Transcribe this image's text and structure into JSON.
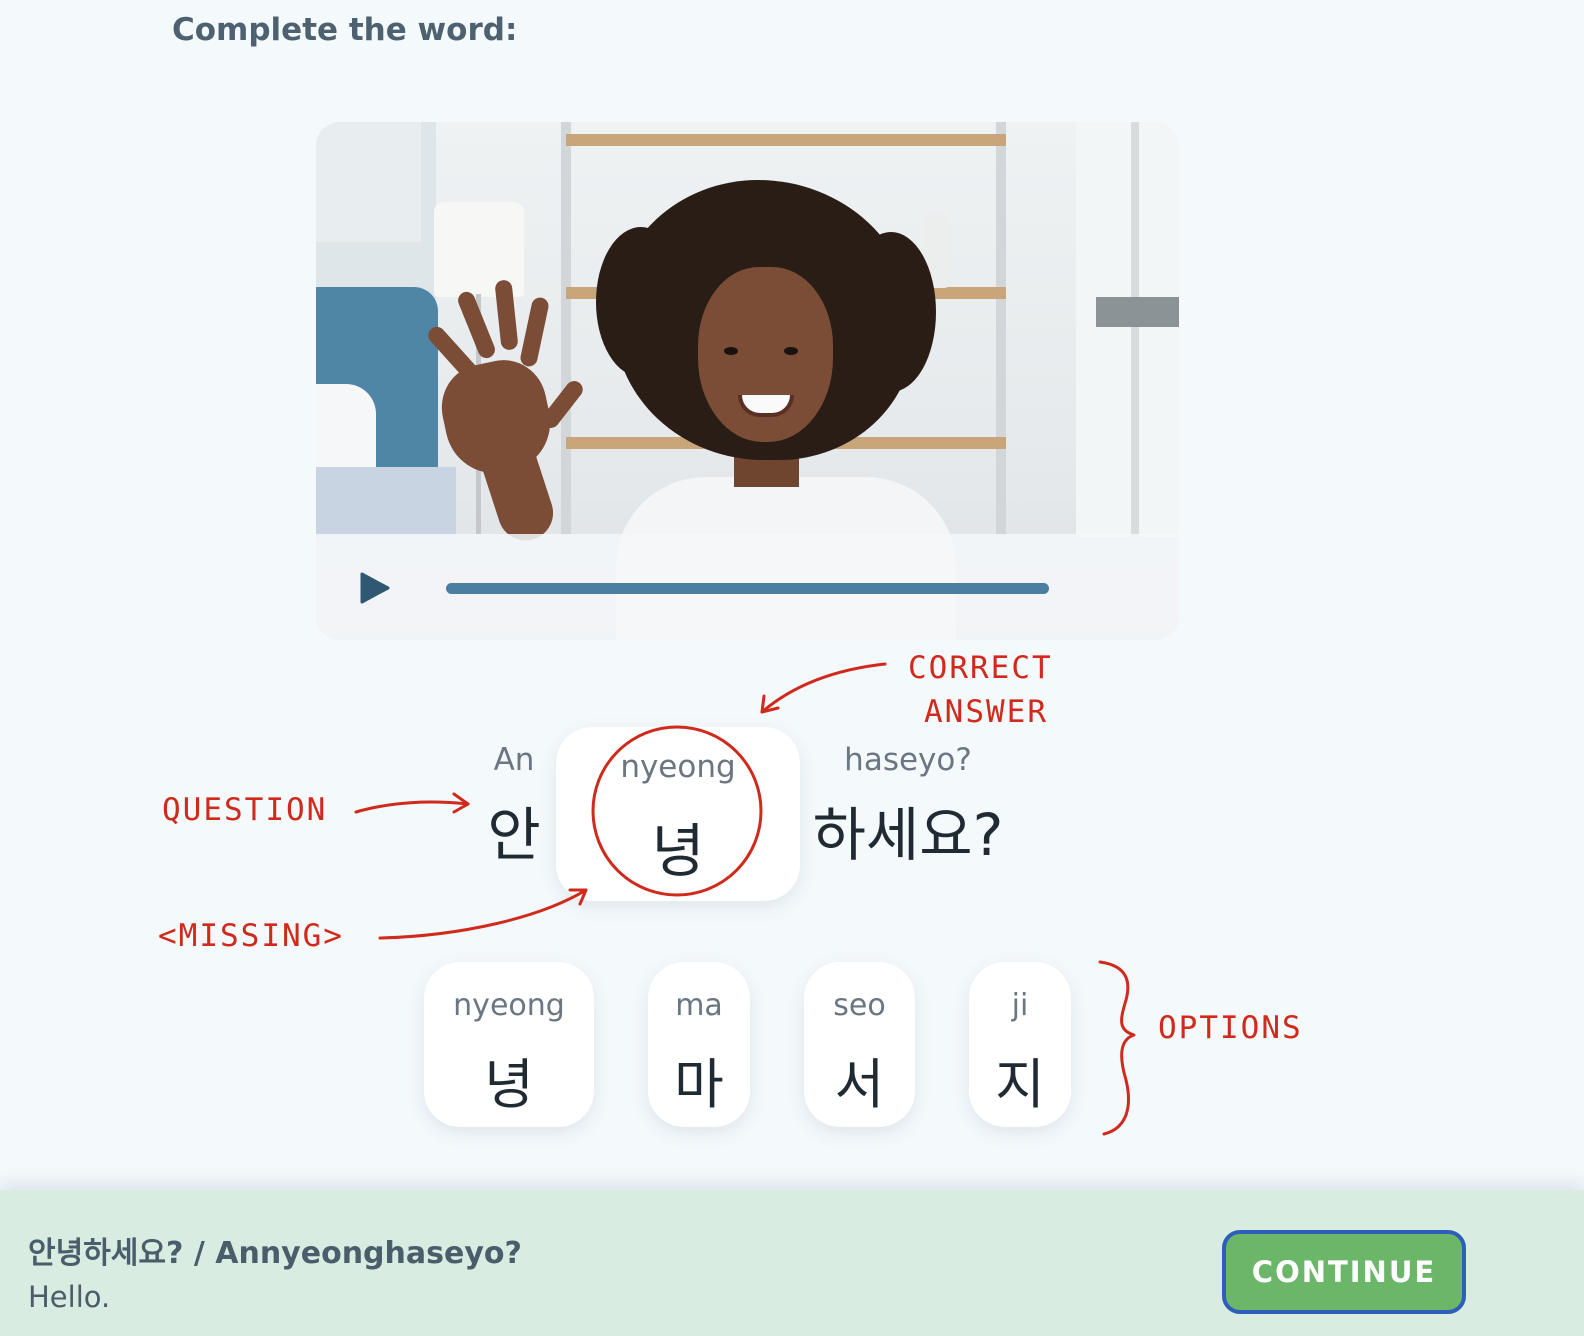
{
  "instruction": "Complete the word:",
  "video": {
    "progress": 1.0,
    "play_icon": "play-icon"
  },
  "question": {
    "syllables": [
      {
        "roman": "An",
        "hangul": "안"
      },
      {
        "roman": "nyeong",
        "hangul": "녕",
        "missing": true
      },
      {
        "roman": "haseyo?",
        "hangul": "하세요?"
      }
    ]
  },
  "options": [
    {
      "roman": "nyeong",
      "hangul": "녕"
    },
    {
      "roman": "ma",
      "hangul": "마"
    },
    {
      "roman": "seo",
      "hangul": "서"
    },
    {
      "roman": "ji",
      "hangul": "지"
    }
  ],
  "annotations": {
    "correct_answer_line1": "CORRECT",
    "correct_answer_line2": "ANSWER",
    "question": "QUESTION",
    "missing": "<MISSING>",
    "options": "OPTIONS",
    "color": "#d02a1c"
  },
  "footer": {
    "title": "안녕하세요? / Annyeonghaseyo?",
    "translation": "Hello.",
    "continue_label": "CONTINUE",
    "continue_color": "#6cb66a",
    "background": "#d9ece1"
  }
}
